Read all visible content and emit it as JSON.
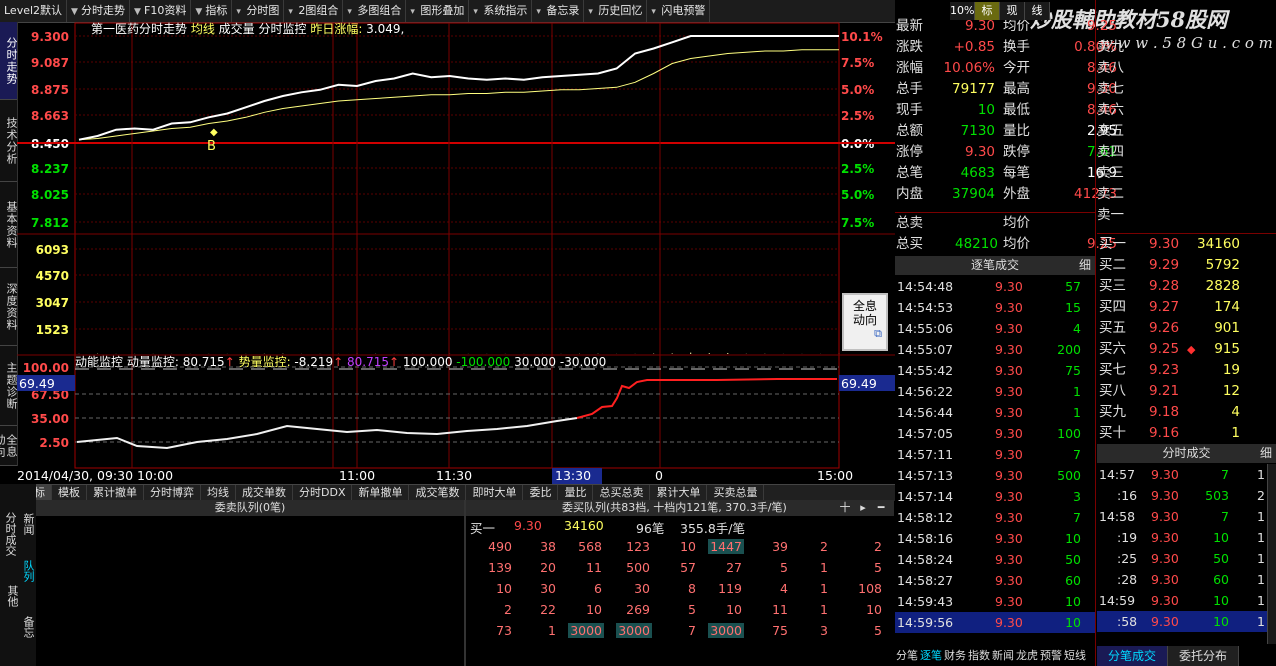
{
  "toolbar": {
    "items": [
      "Level2默认",
      "分时走势",
      "F10资料",
      "指标",
      "分时图",
      "2图组合",
      "多图组合",
      "图形叠加",
      "系统指示",
      "备忘录",
      "历史回忆",
      "闪电预警"
    ],
    "right": [
      "10%",
      "标",
      "现",
      "线"
    ]
  },
  "watermark": {
    "line1": "炒股輔助教材58股网",
    "line2": "w w w . 5 8 G u . c o m"
  },
  "left_tabs": [
    "分时走势",
    "技术分析",
    "基本资料",
    "深度资料",
    "主题诊断",
    "全息动向"
  ],
  "chart": {
    "header": {
      "name": "第一医药分时走势",
      "avg": "均线",
      "vol": "成交量",
      "monitor": "分时监控",
      "prev_change_label": "昨日涨幅:",
      "prev_change": "3.049,"
    },
    "price_axis": [
      "9.300",
      "9.087",
      "8.875",
      "8.663",
      "8.450",
      "8.237",
      "8.025",
      "7.812"
    ],
    "pct_axis": [
      "10.1%",
      "7.5%",
      "5.0%",
      "2.5%",
      "0.0%",
      "2.5%",
      "5.0%",
      "7.5%"
    ],
    "vol_axis": [
      "6093",
      "4570",
      "3047",
      "1523"
    ],
    "ind_axis": [
      "100.00",
      "67.50",
      "35.00",
      "2.50"
    ],
    "ind_current": "69.49",
    "ind_header": {
      "name": "动能监控",
      "a_label": "动量监控:",
      "a_val": "80.715",
      "b_label": "势量监控:",
      "b_val": "-8.219",
      "c": "80.715",
      "d": "100.000",
      "e": "-100.000",
      "f": "30.000",
      "g": "-30.000"
    },
    "marker": "B",
    "popup": "全息动向",
    "time_axis": [
      "2014/04/30, 09:30",
      "10:00",
      "11:00",
      "11:30",
      "13:30",
      "0",
      "15:00"
    ],
    "colors": {
      "price": "#ffffff",
      "avg": "#ffff80",
      "vol": "#ffffb0",
      "indicator_white": "#f0f0f0",
      "indicator_red": "#ff2020"
    }
  },
  "chart_data": {
    "type": "line",
    "series": [
      {
        "name": "价格",
        "values": [
          8.47,
          8.5,
          8.55,
          8.56,
          8.55,
          8.6,
          8.61,
          8.65,
          8.68,
          8.73,
          8.78,
          8.82,
          8.85,
          8.87,
          8.91,
          8.9,
          8.94,
          8.96,
          9.0,
          8.97,
          8.98,
          8.96,
          8.95,
          8.96,
          8.95,
          8.97,
          8.98,
          8.99,
          9.0,
          9.04,
          9.16,
          9.2,
          9.25,
          9.3,
          9.3,
          9.3,
          9.3,
          9.3,
          9.3,
          9.3,
          9.3,
          9.3
        ]
      },
      {
        "name": "均线",
        "values": [
          8.47,
          8.48,
          8.5,
          8.52,
          8.54,
          8.56,
          8.57,
          8.6,
          8.62,
          8.65,
          8.69,
          8.72,
          8.74,
          8.76,
          8.78,
          8.79,
          8.8,
          8.81,
          8.82,
          8.83,
          8.83,
          8.84,
          8.84,
          8.85,
          8.85,
          8.86,
          8.87,
          8.87,
          8.88,
          8.89,
          8.93,
          9.0,
          9.08,
          9.12,
          9.14,
          9.16,
          9.17,
          9.18,
          9.18,
          9.19,
          9.19,
          9.19
        ]
      }
    ],
    "volume": [
      3,
      9,
      2,
      4,
      3,
      2,
      2,
      3,
      4,
      2,
      6,
      7,
      3,
      2,
      4,
      3,
      5,
      2,
      3,
      2,
      3,
      2,
      2,
      4,
      3,
      2,
      3,
      5,
      8,
      3,
      4,
      12,
      18,
      40,
      26,
      28,
      6,
      5,
      4,
      3,
      2,
      2
    ],
    "ylim": [
      7.812,
      9.3
    ],
    "vol_max": 6093
  },
  "stats": {
    "rows": [
      {
        "l1": "最新",
        "v1": "9.30",
        "l2": "均价",
        "v2": "9.25"
      },
      {
        "l1": "涨跌",
        "v1": "+0.85",
        "l2": "换手",
        "v2": "0.80%"
      },
      {
        "l1": "涨幅",
        "v1": "10.06%",
        "l2": "今开",
        "v2": "8.46"
      },
      {
        "l1": "总手",
        "v1": "79177",
        "l2": "最高",
        "v2": "9.30"
      },
      {
        "l1": "现手",
        "v1": "10",
        "l2": "最低",
        "v2": "8.46"
      },
      {
        "l1": "总额",
        "v1": "7130",
        "l2": "量比",
        "v2": "2.95"
      },
      {
        "l1": "涨停",
        "v1": "9.30",
        "l2": "跌停",
        "v2": "7.61"
      },
      {
        "l1": "总笔",
        "v1": "4683",
        "l2": "每笔",
        "v2": "16.9"
      },
      {
        "l1": "内盘",
        "v1": "37904",
        "l2": "外盘",
        "v2": "41273"
      }
    ],
    "total_sell": {
      "label": "总卖",
      "avg_label": "均价"
    },
    "total_buy": {
      "label": "总买",
      "vol": "48210",
      "avg_label": "均价",
      "avg": "9.25"
    }
  },
  "sell_levels": [
    "卖九",
    "卖八",
    "卖七",
    "卖六",
    "卖五",
    "卖四",
    "卖三",
    "卖二",
    "卖一"
  ],
  "buy_levels": [
    {
      "l": "买一",
      "p": "9.30",
      "v": "34160"
    },
    {
      "l": "买二",
      "p": "9.29",
      "v": "5792"
    },
    {
      "l": "买三",
      "p": "9.28",
      "v": "2828"
    },
    {
      "l": "买四",
      "p": "9.27",
      "v": "174"
    },
    {
      "l": "买五",
      "p": "9.26",
      "v": "901"
    },
    {
      "l": "买六",
      "p": "9.25",
      "v": "915"
    },
    {
      "l": "买七",
      "p": "9.23",
      "v": "19"
    },
    {
      "l": "买八",
      "p": "9.21",
      "v": "12"
    },
    {
      "l": "买九",
      "p": "9.18",
      "v": "4"
    },
    {
      "l": "买十",
      "p": "9.16",
      "v": "1"
    }
  ],
  "trades": {
    "header": "逐笔成交",
    "detail": "细",
    "rows": [
      {
        "t": "14:54:48",
        "p": "9.30",
        "v": "57"
      },
      {
        "t": "14:54:53",
        "p": "9.30",
        "v": "15"
      },
      {
        "t": "14:55:06",
        "p": "9.30",
        "v": "4"
      },
      {
        "t": "14:55:07",
        "p": "9.30",
        "v": "200"
      },
      {
        "t": "14:55:42",
        "p": "9.30",
        "v": "75"
      },
      {
        "t": "14:56:22",
        "p": "9.30",
        "v": "1"
      },
      {
        "t": "14:56:44",
        "p": "9.30",
        "v": "1"
      },
      {
        "t": "14:57:05",
        "p": "9.30",
        "v": "100"
      },
      {
        "t": "14:57:11",
        "p": "9.30",
        "v": "7"
      },
      {
        "t": "14:57:13",
        "p": "9.30",
        "v": "500"
      },
      {
        "t": "14:57:14",
        "p": "9.30",
        "v": "3"
      },
      {
        "t": "14:58:12",
        "p": "9.30",
        "v": "7"
      },
      {
        "t": "14:58:16",
        "p": "9.30",
        "v": "10"
      },
      {
        "t": "14:58:24",
        "p": "9.30",
        "v": "50"
      },
      {
        "t": "14:58:27",
        "p": "9.30",
        "v": "60"
      },
      {
        "t": "14:59:43",
        "p": "9.30",
        "v": "10"
      },
      {
        "t": "14:59:56",
        "p": "9.30",
        "v": "10"
      }
    ]
  },
  "minute_trades": {
    "header": "分时成交",
    "detail": "细",
    "rows": [
      {
        "t": "14:57",
        "p": "9.30",
        "v": "7",
        "n": "1"
      },
      {
        "t": ":16",
        "p": "9.30",
        "v": "503",
        "n": "2"
      },
      {
        "t": "14:58",
        "p": "9.30",
        "v": "7",
        "n": "1"
      },
      {
        "t": ":19",
        "p": "9.30",
        "v": "10",
        "n": "1"
      },
      {
        "t": ":25",
        "p": "9.30",
        "v": "50",
        "n": "1"
      },
      {
        "t": ":28",
        "p": "9.30",
        "v": "60",
        "n": "1"
      },
      {
        "t": "14:59",
        "p": "9.30",
        "v": "10",
        "n": "1"
      },
      {
        "t": ":58",
        "p": "9.30",
        "v": "10",
        "n": "1"
      }
    ]
  },
  "bottom_tabs": [
    "指标",
    "模板",
    "累计撤单",
    "分时博弈",
    "均线",
    "成交单数",
    "分时DDX",
    "新单撤单",
    "成交笔数",
    "即时大单",
    "委比",
    "量比",
    "总买总卖",
    "累计大单",
    "买卖总量"
  ],
  "queue": {
    "left_header": "委卖队列(0笔)",
    "right_header": "委买队列(共83档, 十档内121笔, 370.3手/笔)",
    "controls": [
      "十",
      "▸",
      "━"
    ],
    "buy1_label": "买一",
    "buy1_price": "9.30",
    "buy1_vol": "34160",
    "buy1_count": "96笔",
    "buy1_avg": "355.8手/笔",
    "rows": [
      [
        "490",
        "38",
        "568",
        "123",
        "10",
        "1447",
        "39",
        "2",
        "2"
      ],
      [
        "139",
        "20",
        "11",
        "500",
        "57",
        "27",
        "5",
        "1",
        "5"
      ],
      [
        "10",
        "30",
        "6",
        "30",
        "8",
        "119",
        "4",
        "1",
        "108"
      ],
      [
        "2",
        "22",
        "10",
        "269",
        "5",
        "10",
        "11",
        "1",
        "10"
      ],
      [
        "73",
        "1",
        "3000",
        "3000",
        "7",
        "3000",
        "75",
        "3",
        "5"
      ]
    ]
  },
  "side_tabs2": [
    "分时成交",
    "新闻",
    "队列",
    "其他",
    "备忘"
  ],
  "footer_tabs": [
    "分笔",
    "逐笔",
    "财务",
    "指数",
    "新闻",
    "龙虎",
    "预警",
    "短线"
  ],
  "footer_right": [
    "分笔成交",
    "委托分布"
  ]
}
